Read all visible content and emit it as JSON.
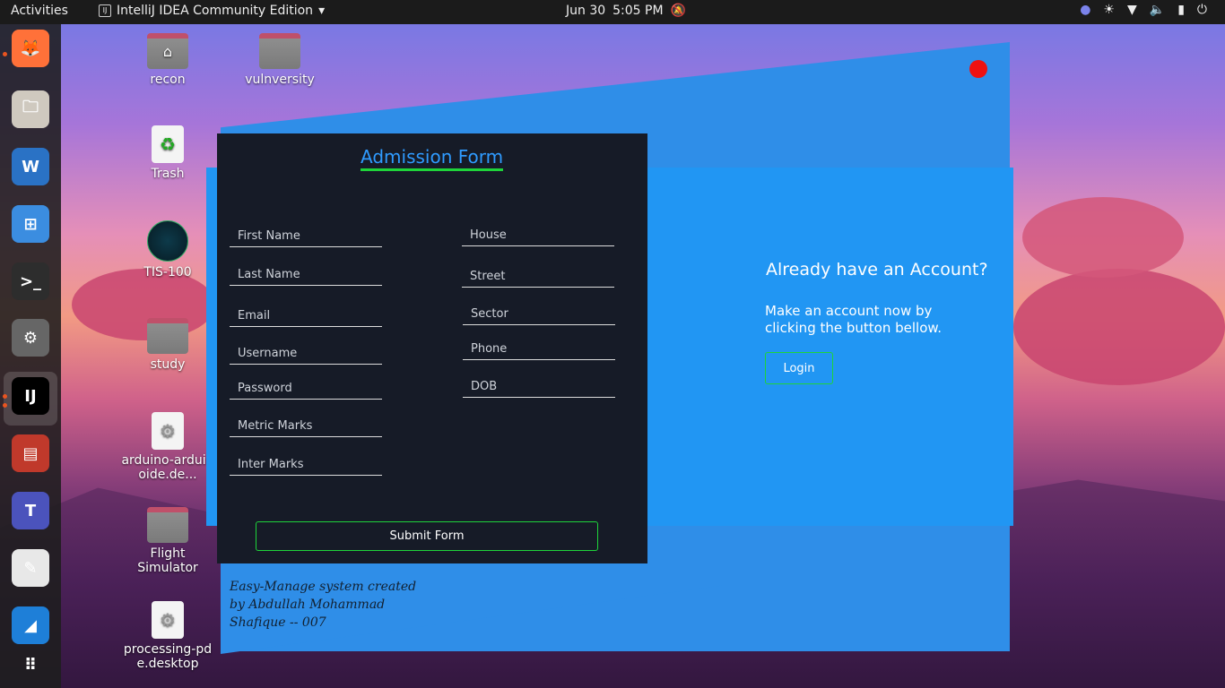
{
  "topbar": {
    "activities": "Activities",
    "app_name": "IntelliJ IDEA Community Edition",
    "app_icon": "IJ",
    "date": "Jun 30",
    "time": "5:05 PM",
    "tray_icons": [
      "teams-icon",
      "brightness-icon",
      "wifi-icon",
      "volume-icon",
      "battery-icon",
      "power-icon"
    ]
  },
  "dock": {
    "items": [
      {
        "name": "firefox",
        "glyph": "🦊",
        "color": "#ff7139"
      },
      {
        "name": "files",
        "glyph": "🗀",
        "color": "#cfc9bf"
      },
      {
        "name": "writer",
        "glyph": "W",
        "color": "#2a72c5"
      },
      {
        "name": "software",
        "glyph": "⊞",
        "color": "#3b8de0"
      },
      {
        "name": "terminal",
        "glyph": ">_",
        "color": "#2d2d2d"
      },
      {
        "name": "settings",
        "glyph": "⚙",
        "color": "#666"
      },
      {
        "name": "intellij",
        "glyph": "IJ",
        "color": "#000"
      },
      {
        "name": "remote",
        "glyph": "▤",
        "color": "#c0392b"
      },
      {
        "name": "teams",
        "glyph": "T",
        "color": "#4b53bc"
      },
      {
        "name": "editor",
        "glyph": "✎",
        "color": "#e8e8e8"
      },
      {
        "name": "vscode",
        "glyph": "◢",
        "color": "#1e7fd8"
      },
      {
        "name": "apps",
        "glyph": "⠿",
        "color": "transparent"
      }
    ]
  },
  "desktop": {
    "icons": [
      {
        "label": "recon",
        "type": "home-folder"
      },
      {
        "label": "vulnversity",
        "type": "folder"
      },
      {
        "label": "Trash",
        "type": "trash"
      },
      {
        "label": "TIS-100",
        "type": "app"
      },
      {
        "label": "study",
        "type": "folder"
      },
      {
        "label": "arduino-arduinoide.de...",
        "type": "file"
      },
      {
        "label": "Flight Simulator",
        "type": "folder"
      },
      {
        "label": "processing-pde.desktop",
        "type": "file"
      }
    ]
  },
  "form": {
    "title": "Admission Form",
    "left_fields": [
      "First Name",
      "Last Name",
      "Email",
      "Username",
      "Password",
      "Metric Marks",
      "Inter Marks"
    ],
    "right_fields": [
      "House",
      "Street",
      "Sector",
      "Phone",
      "DOB"
    ],
    "submit_label": "Submit Form",
    "credit": "Easy-Manage system created by Abdullah Mohammad Shafique -- 007"
  },
  "login_panel": {
    "heading": "Already have an Account?",
    "text": "Make an account now by clicking the button bellow.",
    "button_label": "Login"
  },
  "colors": {
    "accent_blue": "#2196f3",
    "form_bg": "#161b27",
    "green_border": "#1ed43a",
    "close_dot": "#ee1111"
  }
}
